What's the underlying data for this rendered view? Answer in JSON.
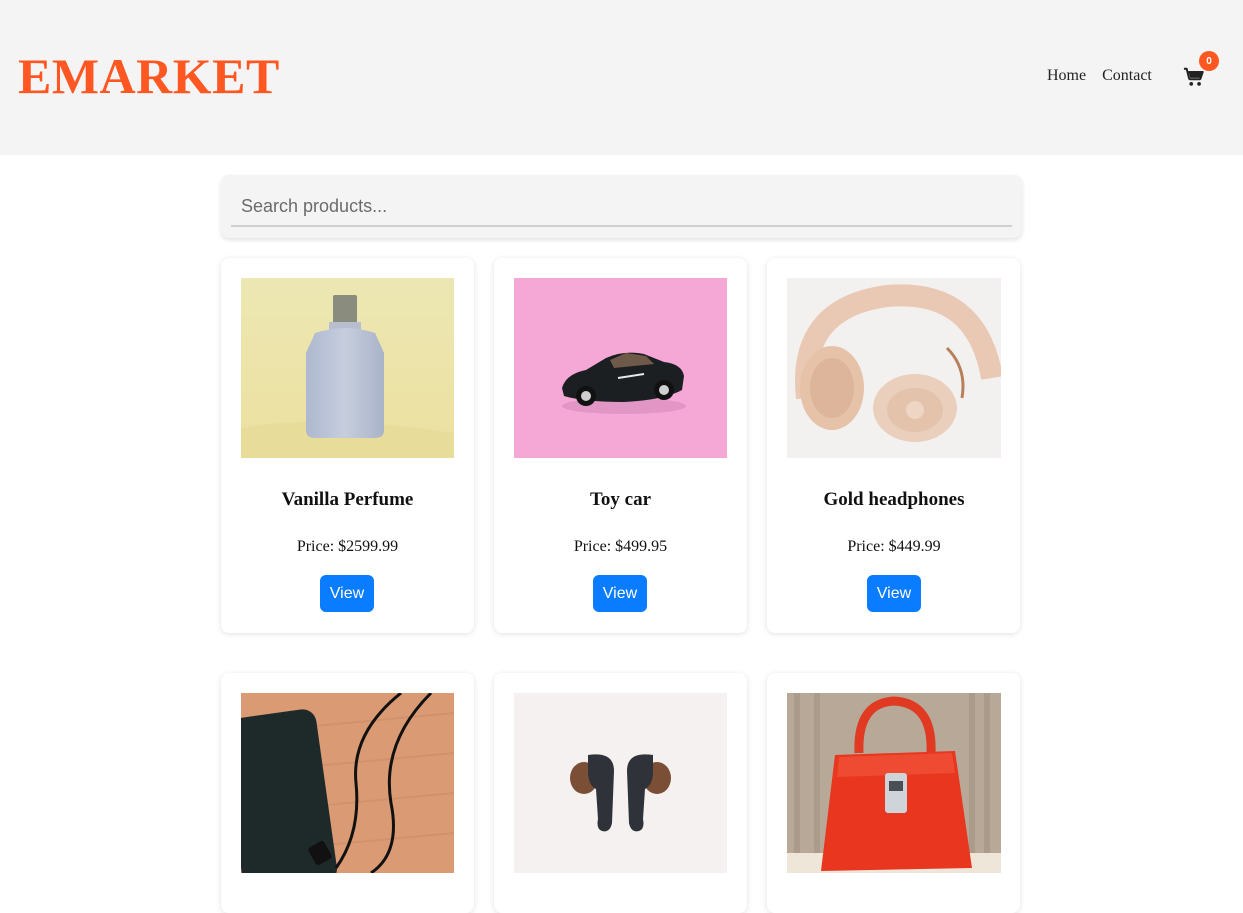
{
  "header": {
    "logo": "EMARKET",
    "nav": [
      {
        "label": "Home"
      },
      {
        "label": "Contact"
      }
    ],
    "cart": {
      "count": "0",
      "icon": "shopping-cart-icon"
    }
  },
  "search": {
    "placeholder": "Search products...",
    "value": ""
  },
  "products": [
    {
      "name": "Vanilla Perfume",
      "price": "Price: $2599.99",
      "button": "View",
      "image": "perfume-bottle"
    },
    {
      "name": "Toy car",
      "price": "Price: $499.95",
      "button": "View",
      "image": "toy-car"
    },
    {
      "name": "Gold headphones",
      "price": "Price: $449.99",
      "button": "View",
      "image": "headphones"
    },
    {
      "name": "",
      "price": "",
      "button": "",
      "image": "power-bank"
    },
    {
      "name": "",
      "price": "",
      "button": "",
      "image": "earbuds"
    },
    {
      "name": "",
      "price": "",
      "button": "",
      "image": "red-handbag"
    }
  ],
  "colors": {
    "brand": "#ff5722",
    "button": "#0a7cff",
    "header_bg": "#f4f4f4"
  }
}
